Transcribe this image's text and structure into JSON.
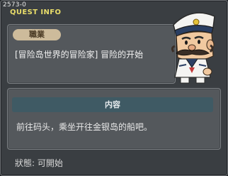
{
  "window": {
    "id": "2573-0",
    "title": "QUEST INFO"
  },
  "quest": {
    "tag": "職業",
    "name": "[冒险岛世界的冒险家] 冒险的开始"
  },
  "content": {
    "header": "内容",
    "text": "前往码头，乘坐开往金银岛的船吧。"
  },
  "status": {
    "text": "狀態: 可開始"
  },
  "npc": {
    "icon": "sailor-captain-npc"
  }
}
